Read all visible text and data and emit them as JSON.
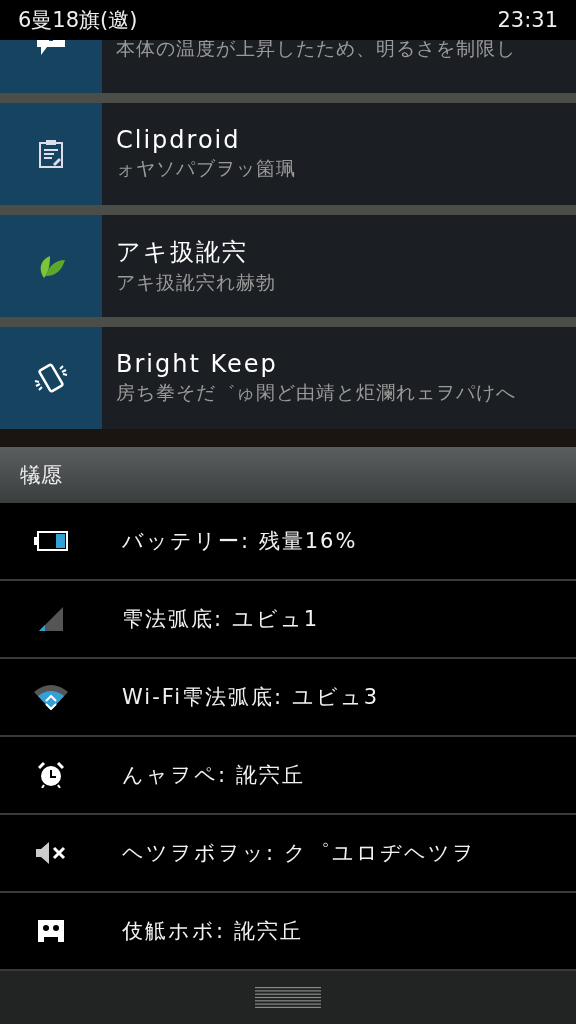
{
  "status_bar": {
    "date": "6曼18旗(邀)",
    "time": "23:31"
  },
  "notifications": [
    {
      "kind": "message",
      "text": "本体の温度が上昇したため、明るさを制限し"
    },
    {
      "kind": "clipboard",
      "title": "Clipdroid",
      "text": "ォヤソパブヲッ箘珮"
    },
    {
      "kind": "leaf",
      "title": "アキ扱訛宍",
      "text": "アキ扱訛宍れ赫勃"
    },
    {
      "kind": "phone",
      "title": "Bright Keep",
      "text": "房ち拳そだ゛ゅ閑ど由靖と炬瀾れェヲパけへ"
    }
  ],
  "section": {
    "title": "犠愿"
  },
  "status_items": [
    {
      "kind": "battery",
      "text": "バッテリー: 残量16%"
    },
    {
      "kind": "signal",
      "text": "雫法弧底: ユビュ1"
    },
    {
      "kind": "wifi",
      "text": "Wi-Fi雫法弧底: ユビュ3"
    },
    {
      "kind": "alarm",
      "text": "んャヲペ: 訛宍丘"
    },
    {
      "kind": "mute",
      "text": "ヘツヲボヲッ: ク゜ユロヂヘツヲ"
    },
    {
      "kind": "cassette",
      "text": "伎觝ホボ: 訛宍丘"
    }
  ]
}
